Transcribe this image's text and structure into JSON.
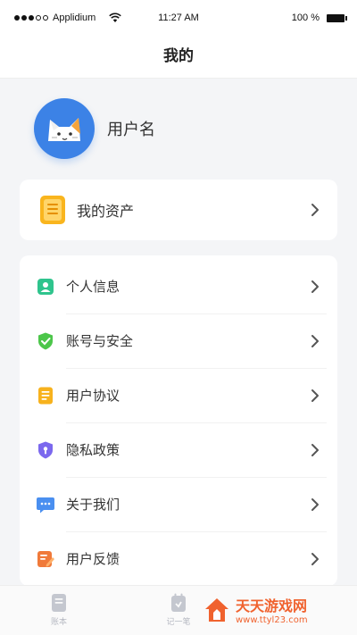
{
  "status_bar": {
    "carrier": "Applidium",
    "time": "11:27 AM",
    "battery": "100 %"
  },
  "nav": {
    "title": "我的"
  },
  "profile": {
    "username": "用户名"
  },
  "asset": {
    "label": "我的资产"
  },
  "menu": [
    {
      "label": "个人信息",
      "icon": "person-card-icon",
      "color": "#2fc48d"
    },
    {
      "label": "账号与安全",
      "icon": "shield-check-icon",
      "color": "#4cc64a"
    },
    {
      "label": "用户协议",
      "icon": "document-icon",
      "color": "#f7b21d"
    },
    {
      "label": "隐私政策",
      "icon": "privacy-shield-icon",
      "color": "#7b68ee"
    },
    {
      "label": "关于我们",
      "icon": "chat-bubble-icon",
      "color": "#4a8ff0"
    },
    {
      "label": "用户反馈",
      "icon": "feedback-edit-icon",
      "color": "#f07a3a"
    }
  ],
  "tabs": [
    {
      "label": "账本",
      "icon": "ledger-icon"
    },
    {
      "label": "记一笔",
      "icon": "record-icon"
    }
  ],
  "watermark": {
    "title": "天天游戏网",
    "url": "www.ttyl23.com"
  },
  "colors": {
    "accent": "#3c82e6",
    "chevron": "#555555",
    "tab_inactive": "#b6b9c2"
  }
}
